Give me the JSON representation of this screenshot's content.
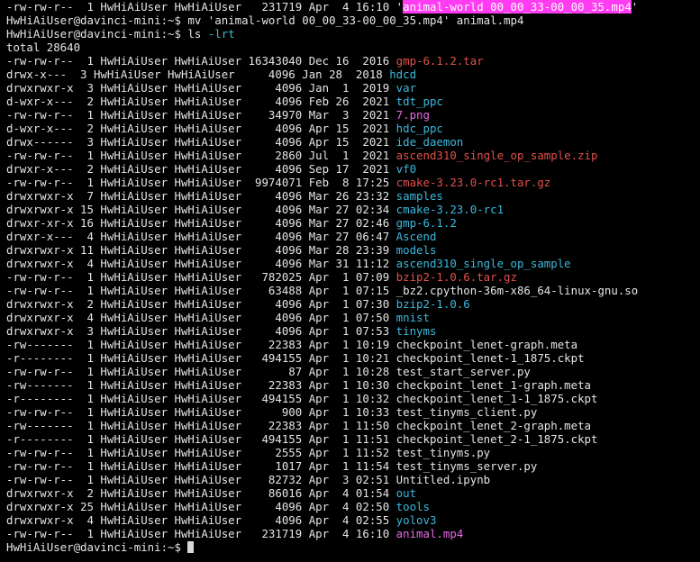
{
  "colors": {
    "background": "#000000",
    "text": "#e5e5e5",
    "dir": "#3cb8dc",
    "archive": "#e0504a",
    "media": "#e76ae6",
    "highlight": "#ff3cf2"
  },
  "top_line": {
    "meta": "-rw-rw-r--  1 HwHiAiUser HwHiAiUser   231719 Apr  4 16:10 ",
    "quote_open": "'",
    "name": "animal-world 00_00_33-00_00_35.mp4",
    "quote_close": "'"
  },
  "cmd1": "HwHiAiUser@davinci-mini:~$ mv 'animal-world 00_00_33-00_00_35.mp4' animal.mp4",
  "cmd2": {
    "prompt": "HwHiAiUser@davinci-mini:~$ ",
    "command": "ls ",
    "flag": "-lrt"
  },
  "total": "total 28640",
  "listing": [
    {
      "meta": "-rw-rw-r--  1 HwHiAiUser HwHiAiUser 16343040 Dec 16  2016 ",
      "name": "gmp-6.1.2.tar",
      "kind": "red"
    },
    {
      "meta": "drwx-x---  3 HwHiAiUser HwHiAiUser     4096 Jan 28  2018 ",
      "name": "hdcd",
      "kind": "cyan"
    },
    {
      "meta": "drwxrwxr-x  3 HwHiAiUser HwHiAiUser     4096 Jan  1  2019 ",
      "name": "var",
      "kind": "cyan"
    },
    {
      "meta": "d-wxr-x---  2 HwHiAiUser HwHiAiUser     4096 Feb 26  2021 ",
      "name": "tdt_ppc",
      "kind": "cyan"
    },
    {
      "meta": "-rw-rw-r--  1 HwHiAiUser HwHiAiUser    34970 Mar  3  2021 ",
      "name": "7.png",
      "kind": "magenta"
    },
    {
      "meta": "d-wxr-x---  2 HwHiAiUser HwHiAiUser     4096 Apr 15  2021 ",
      "name": "hdc_ppc",
      "kind": "cyan"
    },
    {
      "meta": "drwx------  3 HwHiAiUser HwHiAiUser     4096 Apr 15  2021 ",
      "name": "ide_daemon",
      "kind": "cyan"
    },
    {
      "meta": "-rw-rw-r--  1 HwHiAiUser HwHiAiUser     2860 Jul  1  2021 ",
      "name": "ascend310_single_op_sample.zip",
      "kind": "red"
    },
    {
      "meta": "drwxr-x---  2 HwHiAiUser HwHiAiUser     4096 Sep 17  2021 ",
      "name": "vf0",
      "kind": "cyan"
    },
    {
      "meta": "-rw-rw-r--  1 HwHiAiUser HwHiAiUser  9974071 Feb  8 17:25 ",
      "name": "cmake-3.23.0-rc1.tar.gz",
      "kind": "red"
    },
    {
      "meta": "drwxrwxr-x  7 HwHiAiUser HwHiAiUser     4096 Mar 26 23:32 ",
      "name": "samples",
      "kind": "cyan"
    },
    {
      "meta": "drwxrwxr-x 15 HwHiAiUser HwHiAiUser     4096 Mar 27 02:34 ",
      "name": "cmake-3.23.0-rc1",
      "kind": "cyan"
    },
    {
      "meta": "drwxr-xr-x 16 HwHiAiUser HwHiAiUser     4096 Mar 27 02:46 ",
      "name": "gmp-6.1.2",
      "kind": "cyan"
    },
    {
      "meta": "drwxr-x---  4 HwHiAiUser HwHiAiUser     4096 Mar 27 06:47 ",
      "name": "Ascend",
      "kind": "cyan"
    },
    {
      "meta": "drwxrwxr-x 11 HwHiAiUser HwHiAiUser     4096 Mar 28 23:39 ",
      "name": "models",
      "kind": "cyan"
    },
    {
      "meta": "drwxrwxr-x  4 HwHiAiUser HwHiAiUser     4096 Mar 31 11:12 ",
      "name": "ascend310_single_op_sample",
      "kind": "cyan"
    },
    {
      "meta": "-rw-rw-r--  1 HwHiAiUser HwHiAiUser   782025 Apr  1 07:09 ",
      "name": "bzip2-1.0.6.tar.gz",
      "kind": "red"
    },
    {
      "meta": "-rw-rw-r--  1 HwHiAiUser HwHiAiUser    63488 Apr  1 07:15 ",
      "name": "_bz2.cpython-36m-x86_64-linux-gnu.so",
      "kind": "plain"
    },
    {
      "meta": "drwxrwxr-x  2 HwHiAiUser HwHiAiUser     4096 Apr  1 07:30 ",
      "name": "bzip2-1.0.6",
      "kind": "cyan"
    },
    {
      "meta": "drwxrwxr-x  4 HwHiAiUser HwHiAiUser     4096 Apr  1 07:50 ",
      "name": "mnist",
      "kind": "cyan"
    },
    {
      "meta": "drwxrwxr-x  3 HwHiAiUser HwHiAiUser     4096 Apr  1 07:53 ",
      "name": "tinyms",
      "kind": "cyan"
    },
    {
      "meta": "-rw-------  1 HwHiAiUser HwHiAiUser    22383 Apr  1 10:19 ",
      "name": "checkpoint_lenet-graph.meta",
      "kind": "plain"
    },
    {
      "meta": "-r--------  1 HwHiAiUser HwHiAiUser   494155 Apr  1 10:21 ",
      "name": "checkpoint_lenet-1_1875.ckpt",
      "kind": "plain"
    },
    {
      "meta": "-rw-rw-r--  1 HwHiAiUser HwHiAiUser       87 Apr  1 10:28 ",
      "name": "test_start_server.py",
      "kind": "plain"
    },
    {
      "meta": "-rw-------  1 HwHiAiUser HwHiAiUser    22383 Apr  1 10:30 ",
      "name": "checkpoint_lenet_1-graph.meta",
      "kind": "plain"
    },
    {
      "meta": "-r--------  1 HwHiAiUser HwHiAiUser   494155 Apr  1 10:32 ",
      "name": "checkpoint_lenet_1-1_1875.ckpt",
      "kind": "plain"
    },
    {
      "meta": "-rw-rw-r--  1 HwHiAiUser HwHiAiUser      900 Apr  1 10:33 ",
      "name": "test_tinyms_client.py",
      "kind": "plain"
    },
    {
      "meta": "-rw-------  1 HwHiAiUser HwHiAiUser    22383 Apr  1 11:50 ",
      "name": "checkpoint_lenet_2-graph.meta",
      "kind": "plain"
    },
    {
      "meta": "-r--------  1 HwHiAiUser HwHiAiUser   494155 Apr  1 11:51 ",
      "name": "checkpoint_lenet_2-1_1875.ckpt",
      "kind": "plain"
    },
    {
      "meta": "-rw-rw-r--  1 HwHiAiUser HwHiAiUser     2555 Apr  1 11:52 ",
      "name": "test_tinyms.py",
      "kind": "plain"
    },
    {
      "meta": "-rw-rw-r--  1 HwHiAiUser HwHiAiUser     1017 Apr  1 11:54 ",
      "name": "test_tinyms_server.py",
      "kind": "plain"
    },
    {
      "meta": "-rw-rw-r--  1 HwHiAiUser HwHiAiUser    82732 Apr  3 02:51 ",
      "name": "Untitled.ipynb",
      "kind": "plain"
    },
    {
      "meta": "drwxrwxr-x  2 HwHiAiUser HwHiAiUser    86016 Apr  4 01:54 ",
      "name": "out",
      "kind": "cyan"
    },
    {
      "meta": "drwxrwxr-x 25 HwHiAiUser HwHiAiUser     4096 Apr  4 02:50 ",
      "name": "tools",
      "kind": "cyan"
    },
    {
      "meta": "drwxrwxr-x  4 HwHiAiUser HwHiAiUser     4096 Apr  4 02:55 ",
      "name": "yolov3",
      "kind": "cyan"
    },
    {
      "meta": "-rw-rw-r--  1 HwHiAiUser HwHiAiUser   231719 Apr  4 16:10 ",
      "name": "animal.mp4",
      "kind": "magenta"
    }
  ],
  "final_prompt": "HwHiAiUser@davinci-mini:~$ "
}
